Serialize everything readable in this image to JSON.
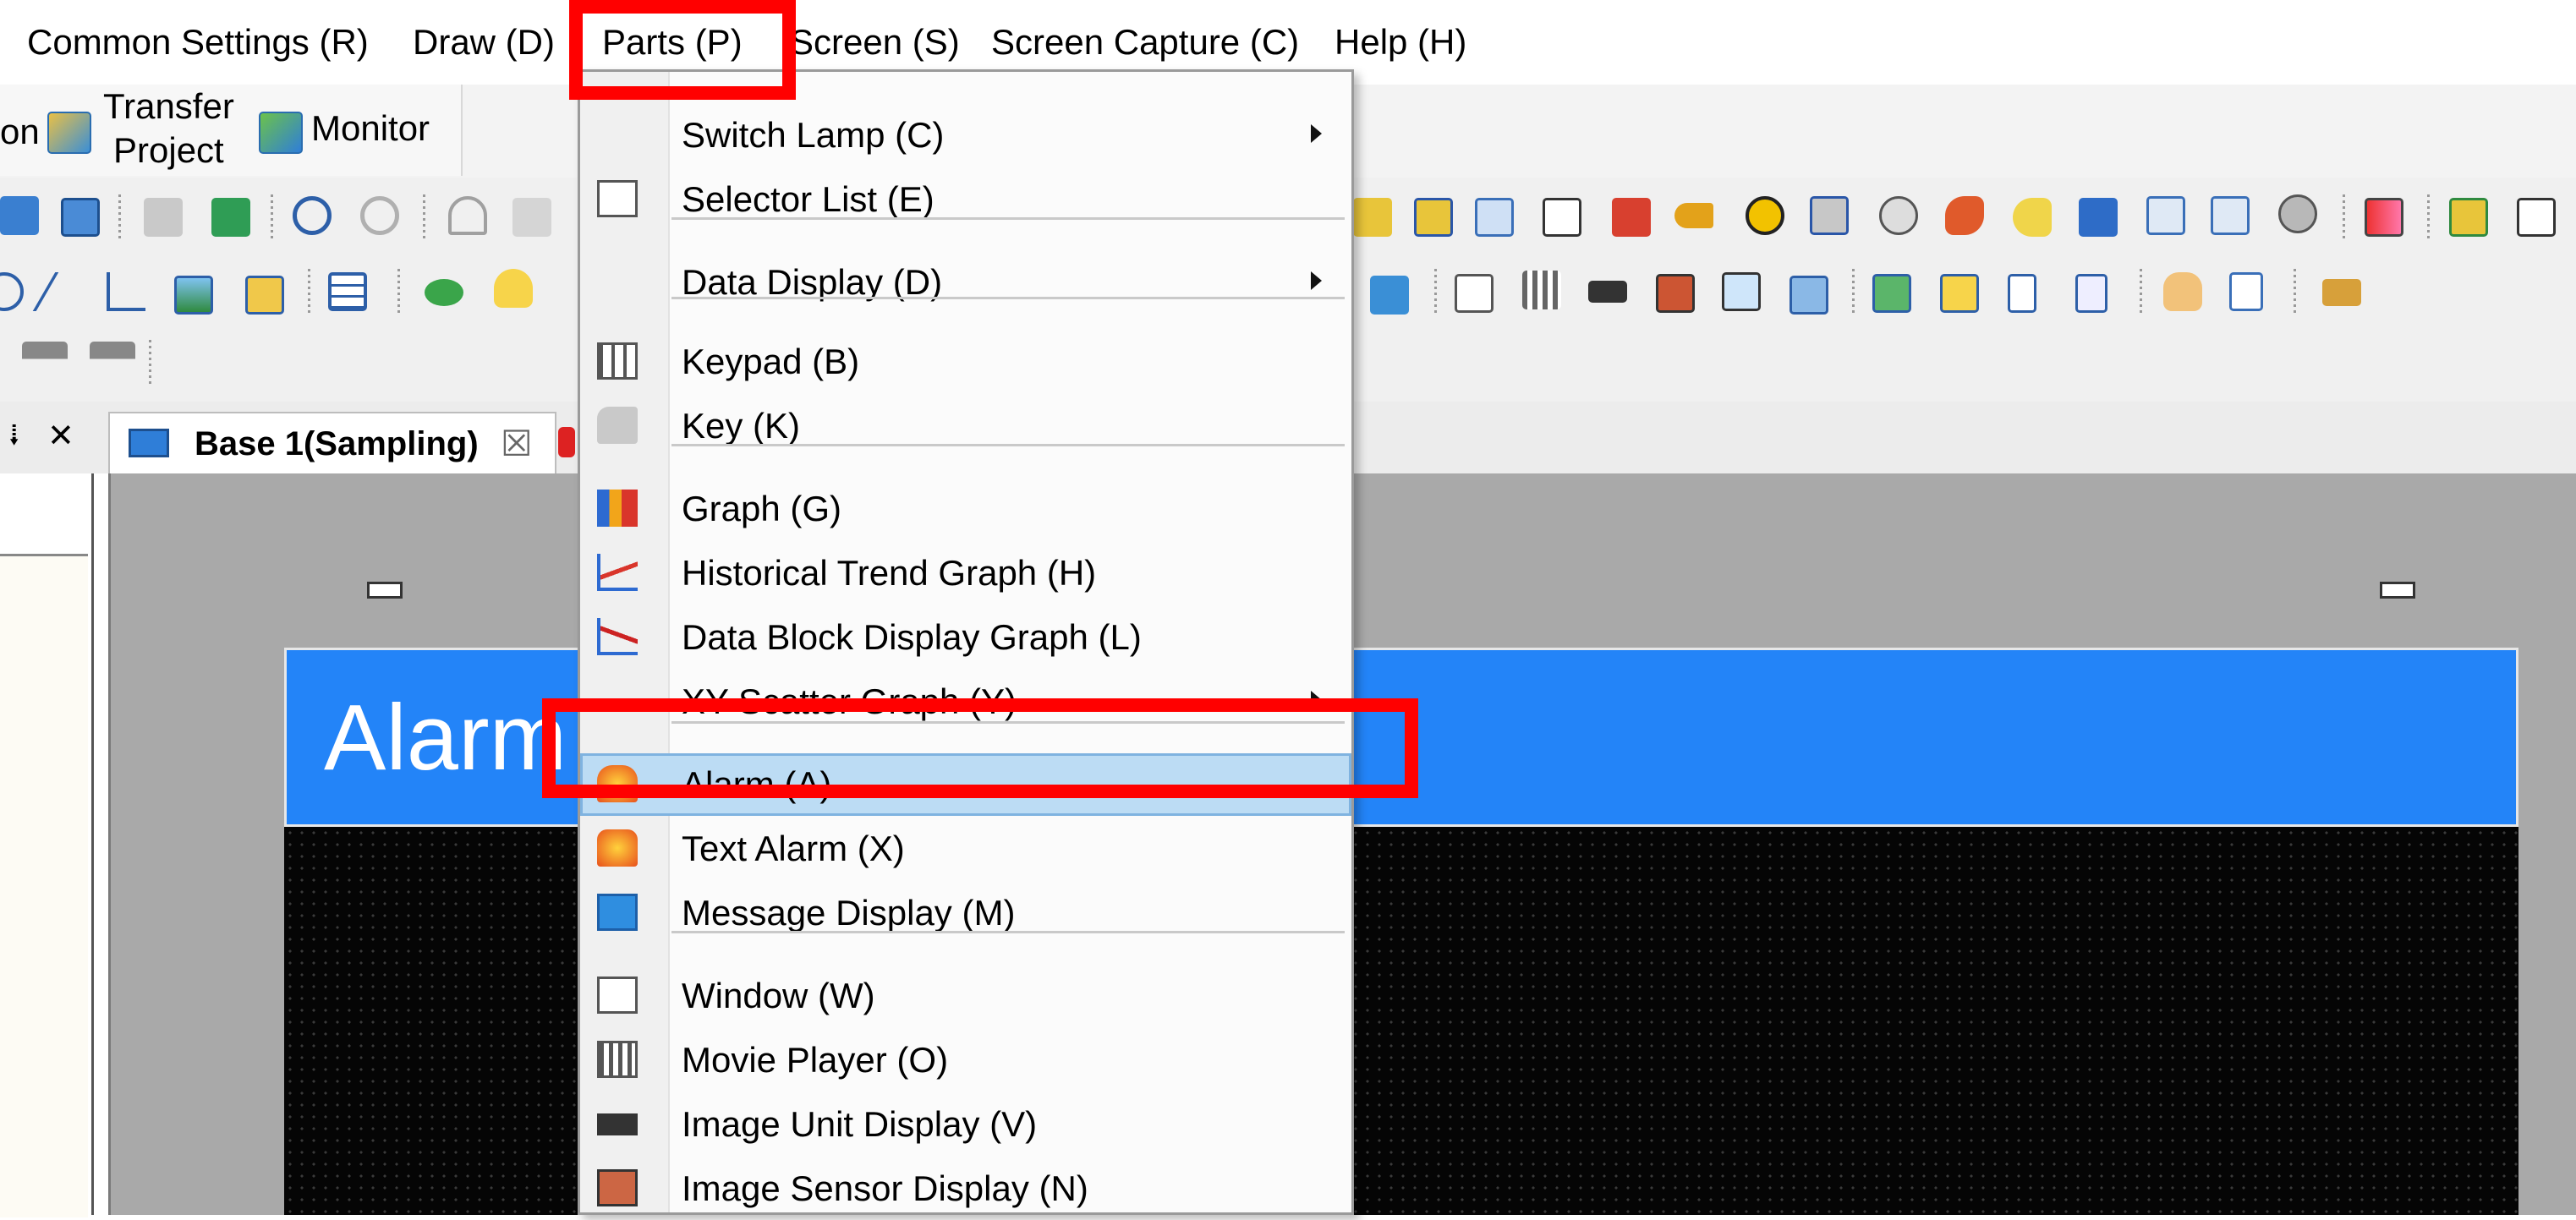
{
  "menubar": {
    "items": [
      {
        "label": "Common Settings (R)"
      },
      {
        "label": "Draw (D)"
      },
      {
        "label": "Parts (P)"
      },
      {
        "label": "Screen (S)"
      },
      {
        "label": "Screen Capture (C)"
      },
      {
        "label": "Help (H)"
      }
    ]
  },
  "ribbon": {
    "partial_label": "on",
    "transfer_line1": "Transfer",
    "transfer_line2": "Project",
    "monitor_label": "Monitor"
  },
  "tabs": {
    "pin_glyph": "⭭",
    "panel_close_glyph": "✕",
    "active_tab_label": "Base 1(Sampling)",
    "tab_close_glyph": "☒"
  },
  "screen": {
    "header_text": "Alarm"
  },
  "parts_menu": {
    "items": [
      {
        "label": "Switch Lamp (C)",
        "icon": "switch-lamp-icon",
        "submenu": true
      },
      {
        "label": "Selector List (E)",
        "icon": "selector-list-icon",
        "submenu": false
      },
      {
        "label": "Data Display (D)",
        "icon": "data-display-icon",
        "submenu": true
      },
      {
        "label": "Keypad (B)",
        "icon": "keypad-icon",
        "submenu": false
      },
      {
        "label": "Key (K)",
        "icon": "key-icon",
        "submenu": false
      },
      {
        "label": "Graph (G)",
        "icon": "bar-graph-icon",
        "submenu": false
      },
      {
        "label": "Historical Trend Graph (H)",
        "icon": "trend-graph-icon",
        "submenu": false
      },
      {
        "label": "Data Block Display Graph (L)",
        "icon": "data-block-graph-icon",
        "submenu": false
      },
      {
        "label": "XY Scatter Graph (Y)",
        "icon": "scatter-graph-icon",
        "submenu": true
      },
      {
        "label": "Alarm (A)",
        "icon": "alarm-icon",
        "submenu": false,
        "highlighted": true
      },
      {
        "label": "Text Alarm (X)",
        "icon": "text-alarm-icon",
        "submenu": false
      },
      {
        "label": "Message Display (M)",
        "icon": "message-display-icon",
        "submenu": false
      },
      {
        "label": "Window (W)",
        "icon": "window-icon",
        "submenu": false
      },
      {
        "label": "Movie Player (O)",
        "icon": "movie-player-icon",
        "submenu": false
      },
      {
        "label": "Image Unit Display (V)",
        "icon": "image-unit-icon",
        "submenu": false
      },
      {
        "label": "Image Sensor Display (N)",
        "icon": "image-sensor-icon",
        "submenu": false
      }
    ]
  },
  "colors": {
    "highlight_red": "#ff0000",
    "menu_hover": "#bcdcf4",
    "screen_header_blue": "#2384f8"
  }
}
